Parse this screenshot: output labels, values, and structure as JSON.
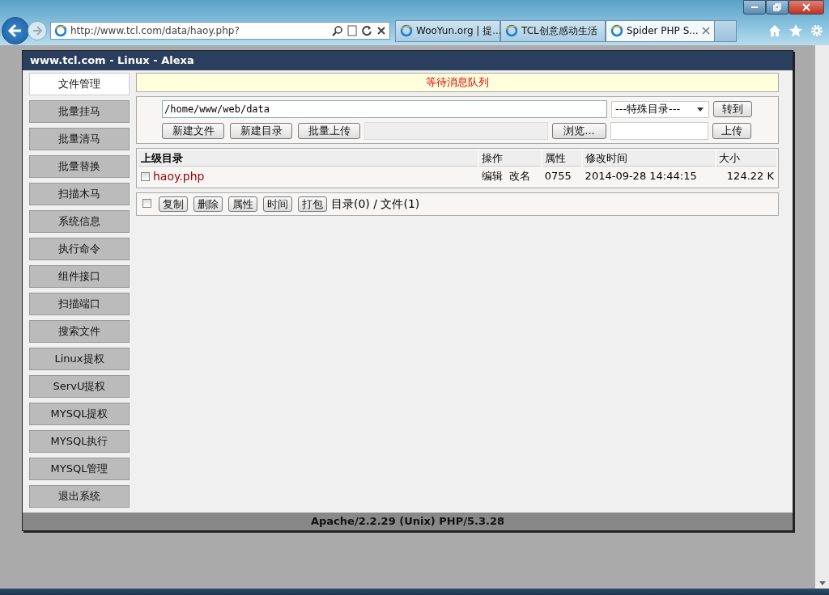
{
  "browser": {
    "address": "http://www.tcl.com/data/haoy.php?",
    "tabs": [
      {
        "title": "WooYun.org | 提...",
        "selected": false
      },
      {
        "title": "TCL创意感动生活",
        "selected": false
      },
      {
        "title": "Spider PHP S...",
        "selected": true
      }
    ]
  },
  "header": "www.tcl.com - Linux - Alexa",
  "sidebar": {
    "items": [
      {
        "label": "文件管理",
        "selected": true
      },
      {
        "label": "批量挂马",
        "selected": false
      },
      {
        "label": "批量清马",
        "selected": false
      },
      {
        "label": "批量替换",
        "selected": false
      },
      {
        "label": "扫描木马",
        "selected": false
      },
      {
        "label": "系统信息",
        "selected": false
      },
      {
        "label": "执行命令",
        "selected": false
      },
      {
        "label": "组件接口",
        "selected": false
      },
      {
        "label": "扫描端口",
        "selected": false
      },
      {
        "label": "搜索文件",
        "selected": false
      },
      {
        "label": "Linux提权",
        "selected": false
      },
      {
        "label": "ServU提权",
        "selected": false
      },
      {
        "label": "MYSQL提权",
        "selected": false
      },
      {
        "label": "MYSQL执行",
        "selected": false
      },
      {
        "label": "MYSQL管理",
        "selected": false
      },
      {
        "label": "退出系统",
        "selected": false
      }
    ]
  },
  "message": "等待消息队列",
  "toolbar": {
    "path": "/home/www/web/data",
    "special_dir": "---特殊目录---",
    "go_button": "转到",
    "buttons": [
      "新建文件",
      "新建目录",
      "批量上传"
    ],
    "browse_button": "浏览...",
    "upload_button": "上传"
  },
  "table": {
    "columns": [
      "上级目录",
      "操作",
      "属性",
      "修改时间",
      "大小"
    ],
    "rows": [
      {
        "name": "haoy.php",
        "checked": false,
        "actions": [
          "编辑",
          "改名"
        ],
        "perms": "0755",
        "modified": "2014-09-28 14:44:15",
        "size": "124.22 K"
      }
    ]
  },
  "bulk": {
    "checked": false,
    "buttons": [
      "复制",
      "删除",
      "属性",
      "时间",
      "打包"
    ],
    "summary": "目录(0) / 文件(1)"
  },
  "footer": "Apache/2.2.29 (Unix) PHP/5.3.28"
}
